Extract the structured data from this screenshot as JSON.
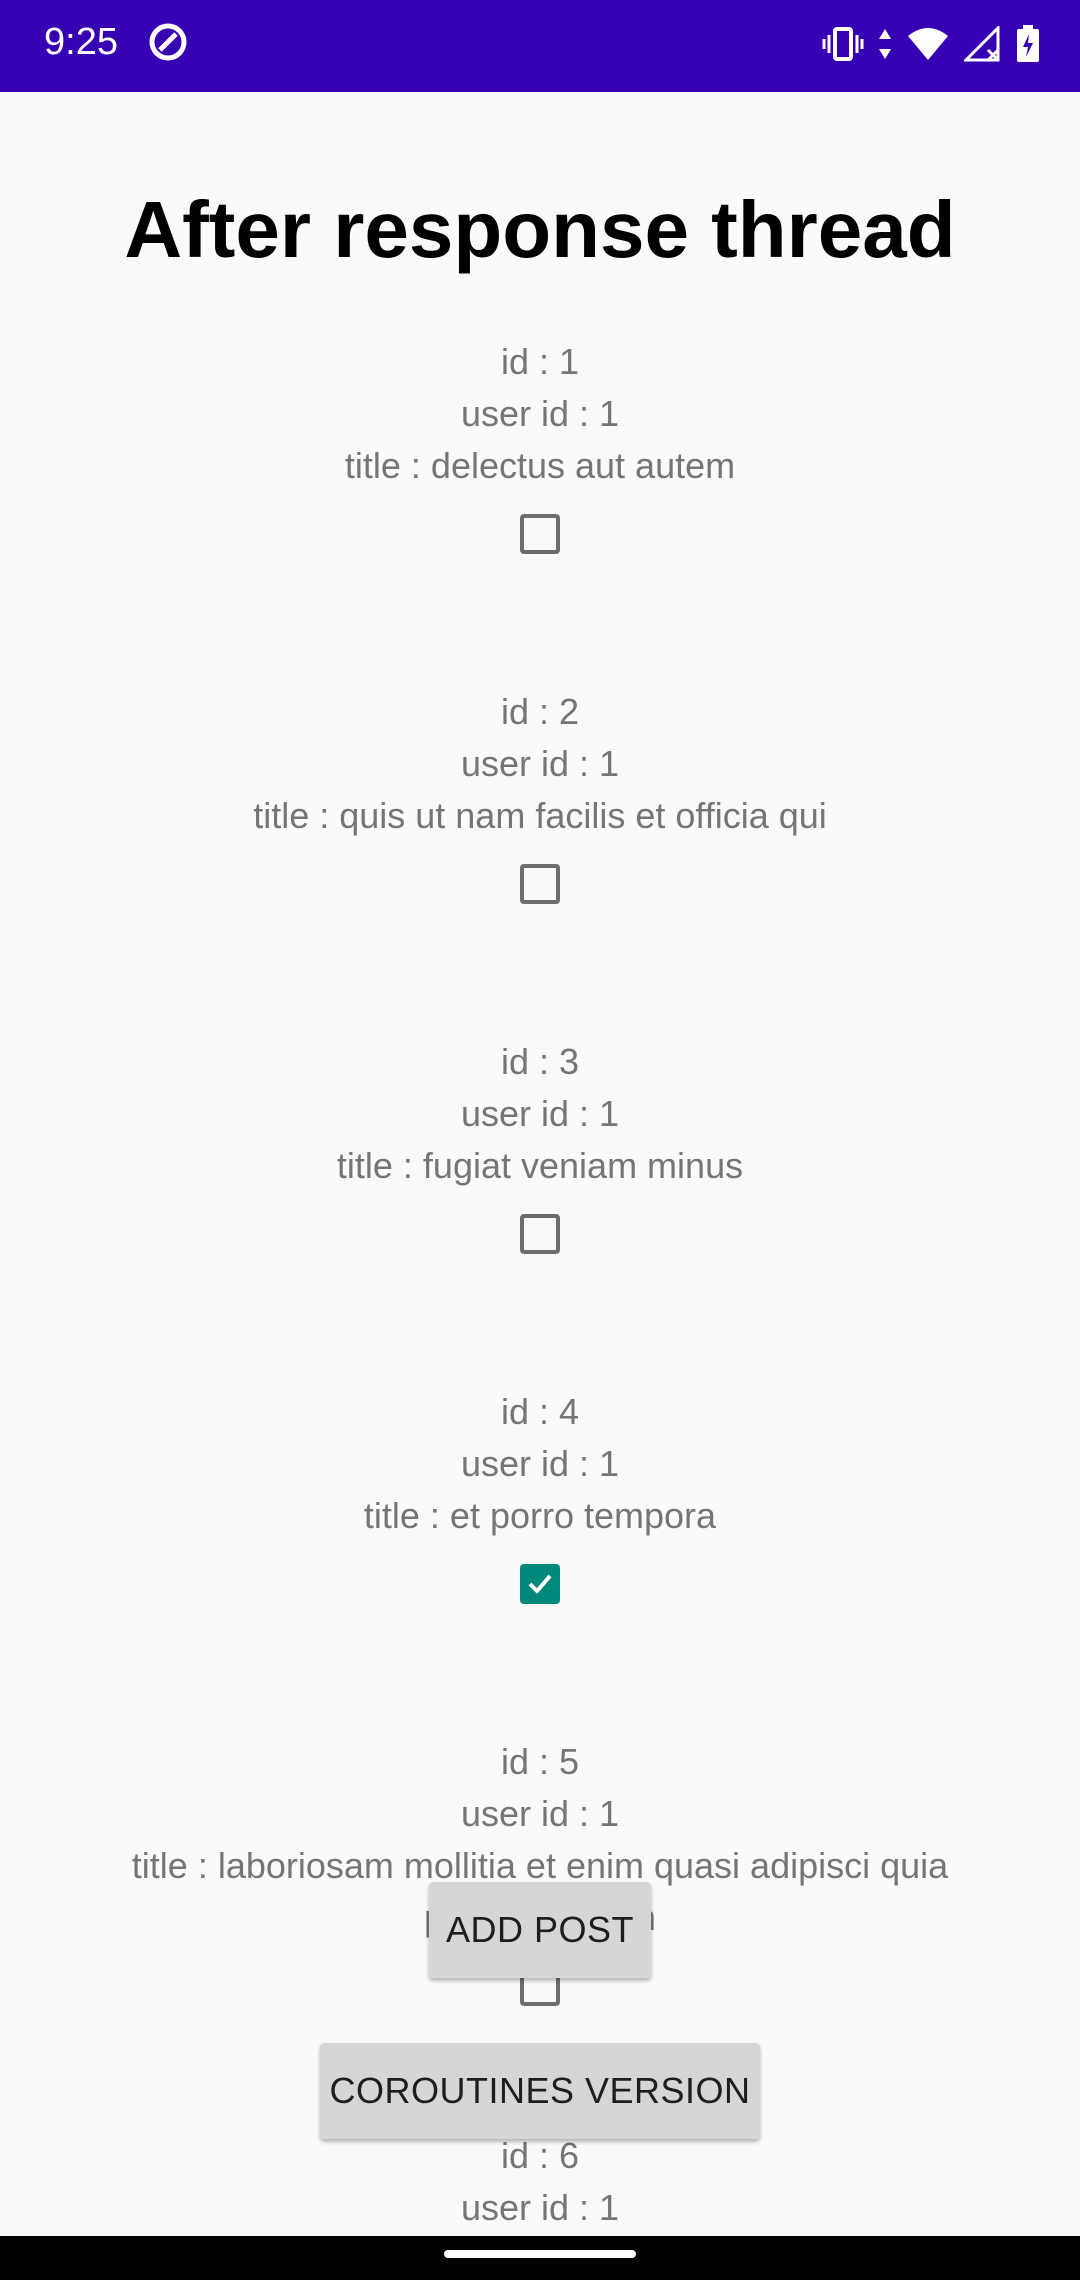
{
  "status_bar": {
    "time": "9:25",
    "color": "#3700b3",
    "icons": [
      "app-circle-icon",
      "vibrate-icon",
      "wifi-icon",
      "signal-icon",
      "battery-charging-icon"
    ]
  },
  "title": "After response thread",
  "posts": [
    {
      "id": "id : 1",
      "user": "user id : 1",
      "title": "title : delectus aut autem",
      "checked": false
    },
    {
      "id": "id : 2",
      "user": "user id : 1",
      "title": "title : quis ut nam facilis et officia qui",
      "checked": false
    },
    {
      "id": "id : 3",
      "user": "user id : 1",
      "title": "title : fugiat veniam minus",
      "checked": false
    },
    {
      "id": "id : 4",
      "user": "user id : 1",
      "title": "title : et porro tempora",
      "checked": true
    },
    {
      "id": "id : 5",
      "user": "user id : 1",
      "title": "title : laboriosam mollitia et enim quasi adipisci quia provident illum",
      "checked": false
    },
    {
      "id": "id : 6",
      "user": "user id : 1"
    }
  ],
  "buttons": {
    "add_post": "ADD POST",
    "coroutines": "COROUTINES VERSION"
  },
  "colors": {
    "checked": "#00897b",
    "text": "#757575"
  }
}
